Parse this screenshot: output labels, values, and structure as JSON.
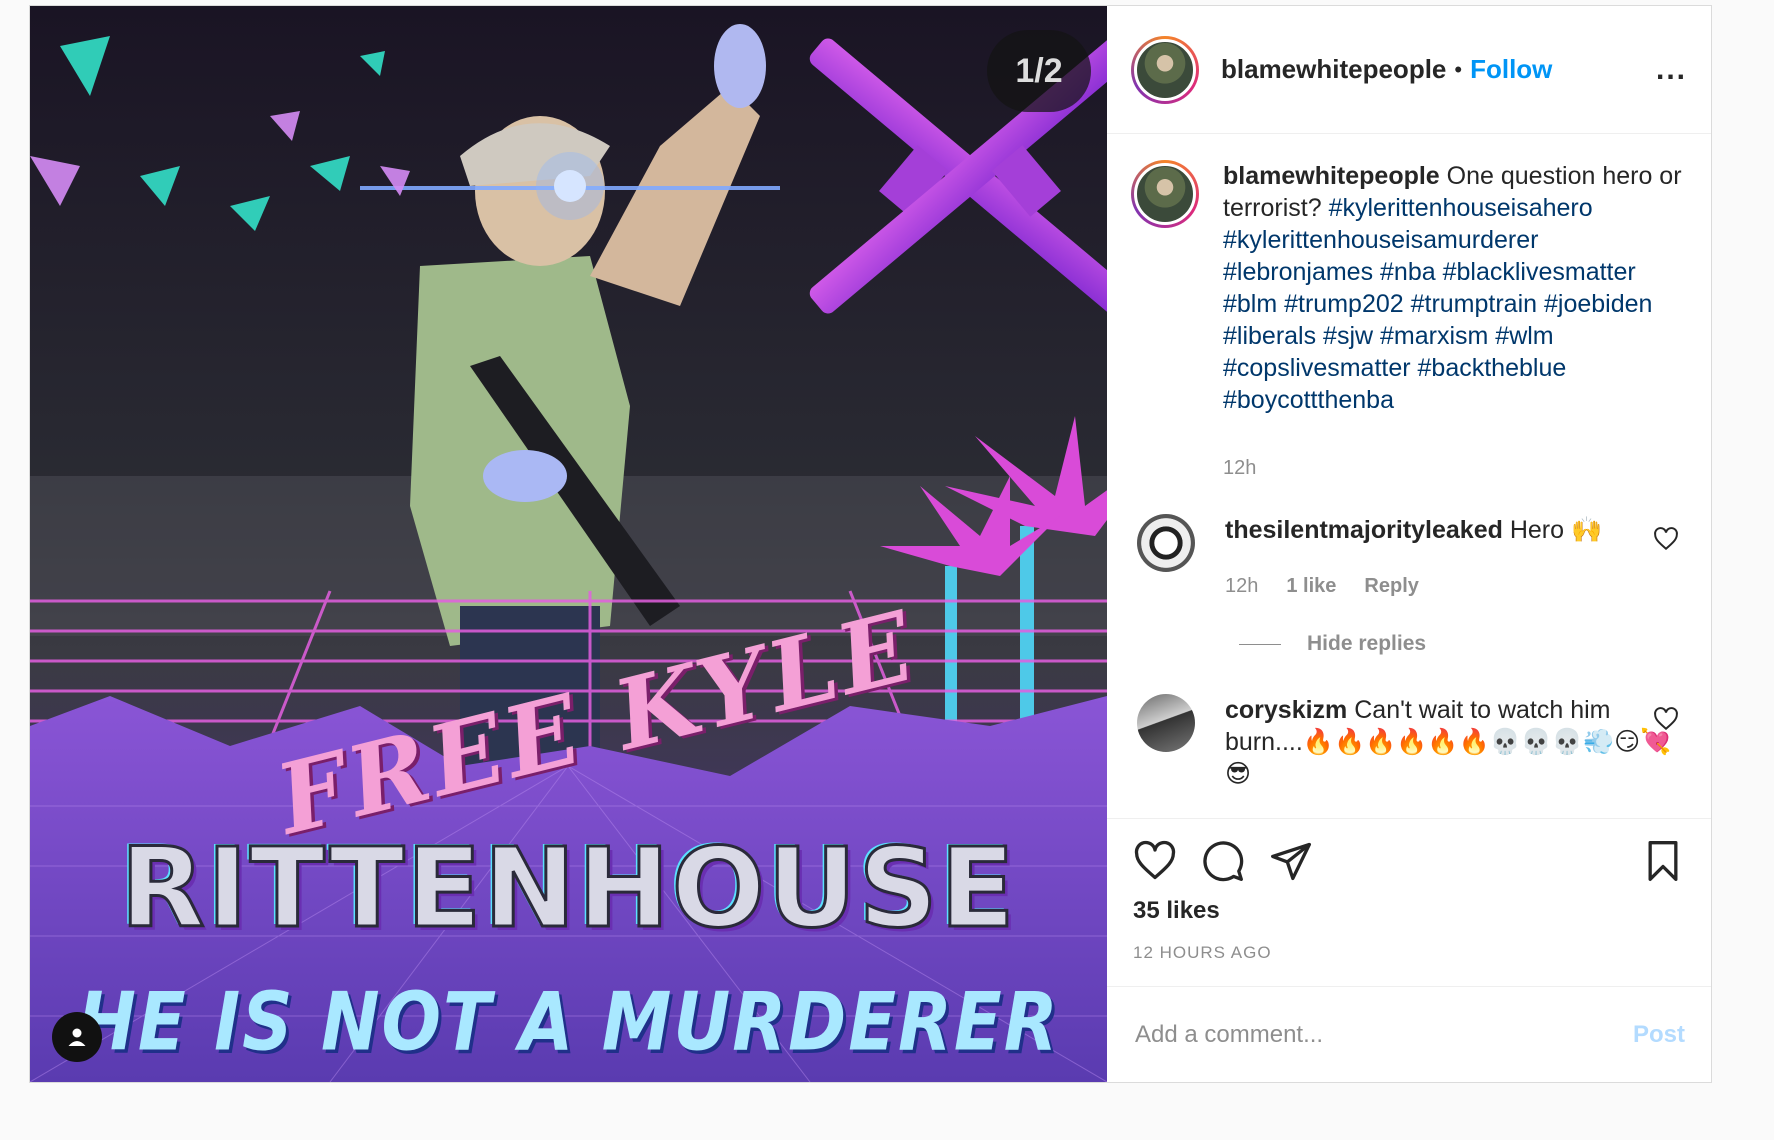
{
  "media": {
    "counter": "1/2",
    "image_text": {
      "script_line": "FREE KYLE",
      "big_line": "RITTENHOUSE",
      "bottom_line": "HE IS NOT A MURDERER"
    },
    "tag_icon": "user-tag-icon"
  },
  "header": {
    "username": "blamewhitepeople",
    "separator": "•",
    "follow_label": "Follow",
    "more_label": "..."
  },
  "caption": {
    "username": "blamewhitepeople",
    "text": " One question hero or terrorist? ",
    "hashtags": "#kylerittenhouseisahero #kylerittenhouseisamurderer #lebronjames #nba #blacklivesmatter #blm #trump202 #trumptrain #joebiden #liberals #sjw #marxism #wlm #copslivesmatter #backtheblue #boycottthenba",
    "time": "12h"
  },
  "comments": [
    {
      "username": "thesilentmajorityleaked",
      "text": " Hero 🙌",
      "time": "12h",
      "likes": "1 like",
      "reply_label": "Reply"
    },
    {
      "username": "coryskizm",
      "text": " Can't wait to watch him burn....🔥🔥🔥🔥🔥🔥💀💀💀💨😏💘 😎"
    }
  ],
  "hide_replies_label": "Hide replies",
  "actions": {
    "likes": "35 likes",
    "timestamp": "12 HOURS AGO"
  },
  "add_comment": {
    "placeholder": "Add a comment...",
    "post_label": "Post"
  },
  "colors": {
    "link_blue": "#0095f6",
    "hashtag_blue": "#00376b",
    "post_disabled": "#b3dbff",
    "muted": "#8e8e8e"
  }
}
